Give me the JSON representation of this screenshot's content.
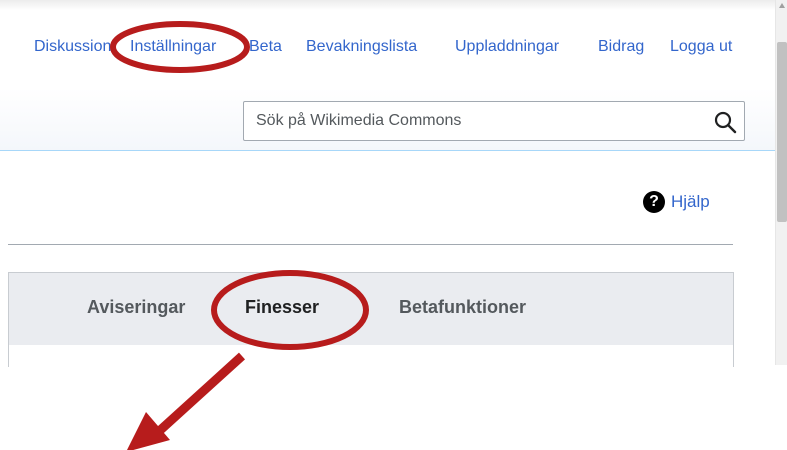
{
  "personal_tools": {
    "items": [
      "Diskussion",
      "Inställningar",
      "Beta",
      "Bevakningslista",
      "Uppladdningar",
      "Bidrag",
      "Logga ut"
    ]
  },
  "search": {
    "placeholder": "Sök på Wikimedia Commons",
    "icon": "search-icon"
  },
  "help": {
    "label": "Hjälp",
    "icon_glyph": "?"
  },
  "tabs": {
    "items": [
      "Aviseringar",
      "Finesser",
      "Betafunktioner"
    ],
    "active": "Finesser"
  },
  "annotations": {
    "color": "#b71c1c",
    "highlighted": [
      "Inställningar",
      "Finesser"
    ],
    "arrow": "pointing down-left from Finesser"
  },
  "colors": {
    "link": "#3366cc",
    "search_border": "#a2a9b1",
    "tab_bar": "#eaecf0"
  }
}
